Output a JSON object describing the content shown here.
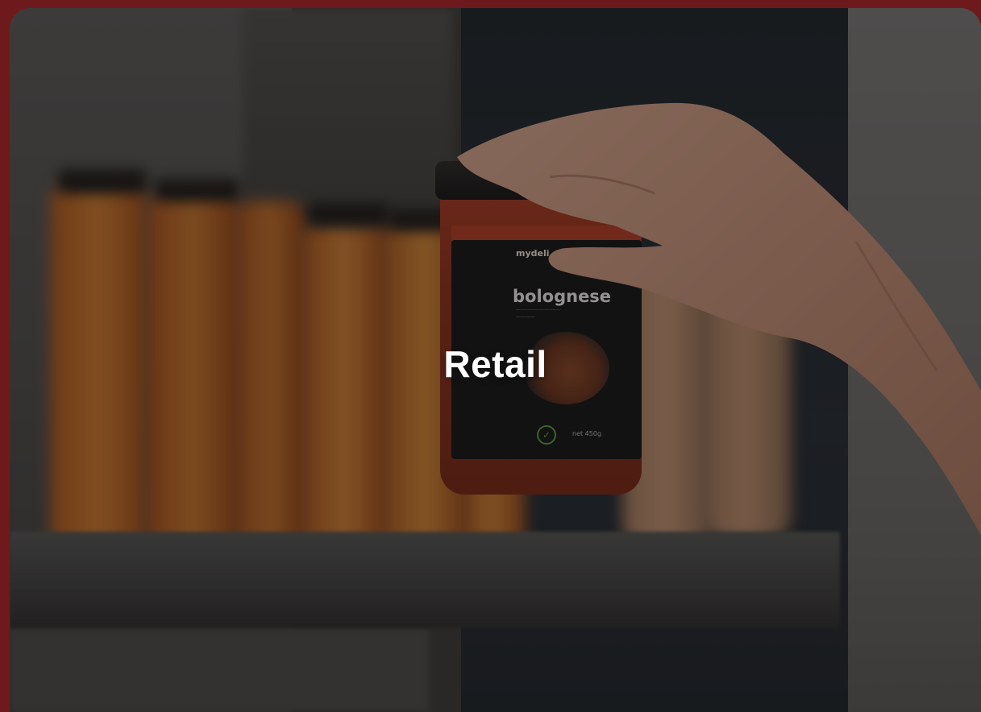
{
  "card": {
    "title": "Retail"
  },
  "photo": {
    "jar_brand": "mydeli",
    "jar_product": "bolognese",
    "jar_net_weight": "net 450g"
  },
  "colors": {
    "page_background": "#6e1a1c",
    "title_text": "#ffffff",
    "overlay": "rgba(20,20,20,0.42)"
  }
}
